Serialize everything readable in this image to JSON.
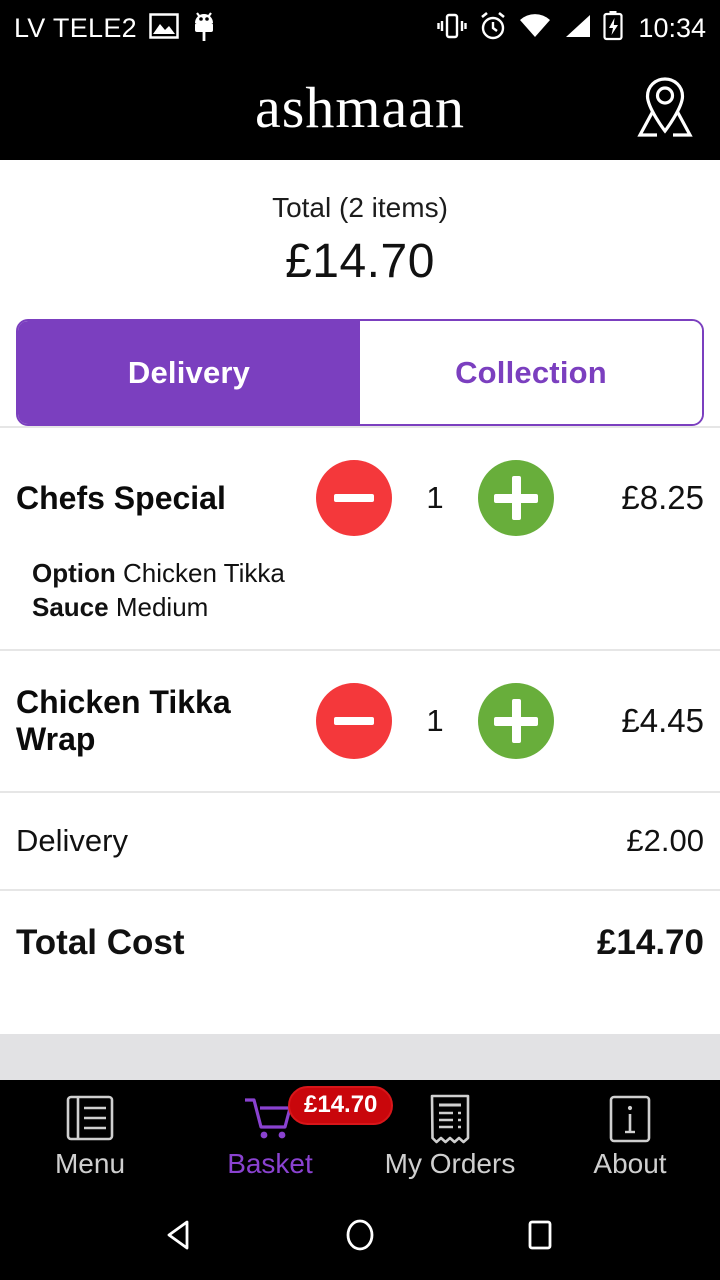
{
  "statusbar": {
    "carrier": "LV TELE2",
    "clock": "10:34",
    "icons_left": [
      "image-icon",
      "android-debug-icon"
    ],
    "icons_right": [
      "vibrate-icon",
      "alarm-icon",
      "wifi-icon",
      "signal-icon",
      "battery-charging-icon"
    ]
  },
  "header": {
    "brand": "ashmaan",
    "location_icon": "map-pin-icon"
  },
  "summary": {
    "total_label": "Total (2 items)",
    "total_amount": "£14.70"
  },
  "fulfilment": {
    "options": [
      {
        "label": "Delivery",
        "selected": true
      },
      {
        "label": "Collection",
        "selected": false
      }
    ]
  },
  "basket": {
    "items": [
      {
        "name": "Chefs Special",
        "qty": "1",
        "price": "£8.25",
        "decrease_icon": "minus-circle-icon",
        "increase_icon": "plus-circle-icon",
        "options": [
          {
            "label": "Option",
            "value": "Chicken Tikka"
          },
          {
            "label": "Sauce",
            "value": "Medium"
          }
        ]
      },
      {
        "name": "Chicken Tikka Wrap",
        "qty": "1",
        "price": "£4.45",
        "decrease_icon": "minus-circle-icon",
        "increase_icon": "plus-circle-icon",
        "options": []
      }
    ],
    "delivery_label": "Delivery",
    "delivery_value": "£2.00",
    "total_label": "Total Cost",
    "total_value": "£14.70"
  },
  "bottom_nav": {
    "items": [
      {
        "label": "Menu",
        "icon": "menu-book-icon",
        "active": false
      },
      {
        "label": "Basket",
        "icon": "shopping-cart-icon",
        "active": true,
        "badge": "£14.70"
      },
      {
        "label": "My Orders",
        "icon": "receipt-icon",
        "active": false
      },
      {
        "label": "About",
        "icon": "info-icon",
        "active": false
      }
    ]
  },
  "system_nav": {
    "back": "back-triangle-icon",
    "home": "home-circle-icon",
    "recents": "recents-square-icon"
  },
  "colors": {
    "brand_purple": "#7b3fbf",
    "accent_red": "#f4383b",
    "accent_green": "#68ae3b",
    "badge_red": "#c9060b",
    "nav_active": "#8a42d0"
  }
}
